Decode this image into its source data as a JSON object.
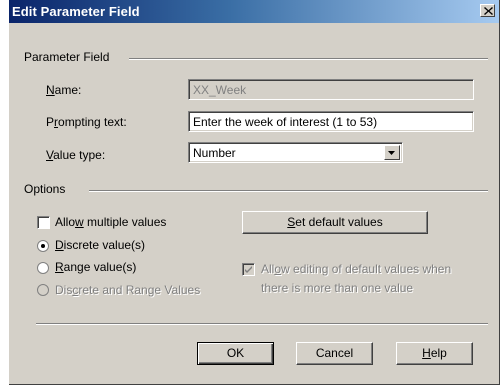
{
  "window": {
    "title": "Edit Parameter Field",
    "close_icon": "close-icon"
  },
  "parameter_field_group": {
    "label": "Parameter Field",
    "name": {
      "label_pre": "",
      "label_acc": "N",
      "label_post": "ame:",
      "value": "XX_Week"
    },
    "prompting_text": {
      "label_pre": "P",
      "label_acc": "r",
      "label_post": "ompting text:",
      "value": "Enter the week of interest (1 to 53)"
    },
    "value_type": {
      "label_pre": "",
      "label_acc": "V",
      "label_post": "alue type:",
      "value": "Number"
    }
  },
  "options_group": {
    "label": "Options",
    "allow_multiple": {
      "label_pre": "Allo",
      "label_acc": "w",
      "label_post": " multiple values",
      "checked": false
    },
    "discrete": {
      "label_pre": "",
      "label_acc": "D",
      "label_post": "iscrete value(s)",
      "selected": true
    },
    "range": {
      "label_pre": "",
      "label_acc": "R",
      "label_post": "ange value(s)",
      "selected": false
    },
    "discrete_and_range": {
      "label_pre": "Dis",
      "label_acc": "c",
      "label_post": "rete and Range Values",
      "selected": false,
      "enabled": false
    },
    "set_default": {
      "label_pre": "",
      "label_acc": "S",
      "label_post": "et default values"
    },
    "allow_editing": {
      "label_line1_pre": "All",
      "label_line1_acc": "o",
      "label_line1_post": "w editing of default values when",
      "label_line2": "there is more than one value",
      "checked": true,
      "enabled": false
    }
  },
  "buttons": {
    "ok": "OK",
    "cancel": "Cancel",
    "help_pre": "",
    "help_acc": "H",
    "help_post": "elp"
  },
  "colors": {
    "dialog_face": "#d4d0c8",
    "title_start": "#0a246a",
    "title_end": "#a6caf0",
    "disabled_text": "#808080"
  }
}
